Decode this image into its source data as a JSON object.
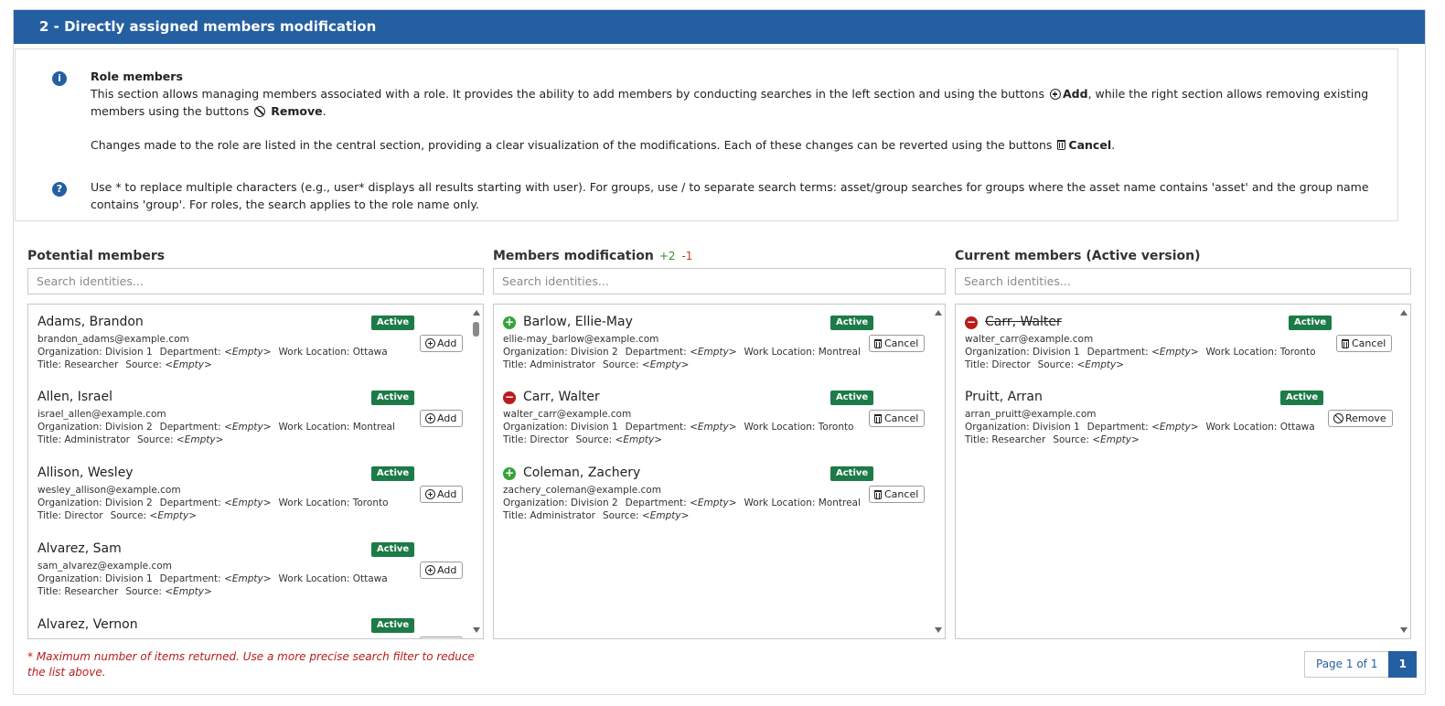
{
  "header": {
    "title": "2 - Directly assigned members modification"
  },
  "info": {
    "title": "Role members",
    "p1_a": "This section allows managing members associated with a role. It provides the ability to add members by conducting searches in the left section and using the buttons",
    "p1_add": "Add",
    "p1_b": ", while the right section allows removing existing members using the buttons",
    "p1_remove": "Remove",
    "p1_end": ".",
    "p2_a": "Changes made to the role are listed in the central section, providing a clear visualization of the modifications. Each of these changes can be reverted using the buttons",
    "p2_cancel": "Cancel",
    "p2_end": ".",
    "help": "Use * to replace multiple characters (e.g., user* displays all results starting with user). For groups, use / to separate search terms: asset/group searches for groups where the asset name contains 'asset' and the group name contains 'group'. For roles, the search applies to the role name only."
  },
  "labels": {
    "organization": "Organization:",
    "department": "Department:",
    "work_location": "Work Location:",
    "title": "Title:",
    "source": "Source:",
    "empty": "<Empty>",
    "active": "Active",
    "add": "Add",
    "cancel": "Cancel",
    "remove": "Remove"
  },
  "columns": {
    "potential": {
      "title": "Potential members",
      "search_placeholder": "Search identities...",
      "items": [
        {
          "name": "Adams, Brandon",
          "email": "brandon_adams@example.com",
          "organization": "Division 1",
          "work_location": "Ottawa",
          "title": "Researcher"
        },
        {
          "name": "Allen, Israel",
          "email": "israel_allen@example.com",
          "organization": "Division 2",
          "work_location": "Montreal",
          "title": "Administrator"
        },
        {
          "name": "Allison, Wesley",
          "email": "wesley_allison@example.com",
          "organization": "Division 2",
          "work_location": "Toronto",
          "title": "Director"
        },
        {
          "name": "Alvarez, Sam",
          "email": "sam_alvarez@example.com",
          "organization": "Division 1",
          "work_location": "Ottawa",
          "title": "Researcher"
        },
        {
          "name": "Alvarez, Vernon"
        }
      ]
    },
    "modification": {
      "title": "Members modification",
      "delta_plus": "+2",
      "delta_minus": "-1",
      "search_placeholder": "Search identities...",
      "items": [
        {
          "change": "add",
          "name": "Barlow, Ellie-May",
          "email": "ellie-may_barlow@example.com",
          "organization": "Division 2",
          "work_location": "Montreal",
          "title": "Administrator"
        },
        {
          "change": "remove",
          "name": "Carr, Walter",
          "email": "walter_carr@example.com",
          "organization": "Division 1",
          "work_location": "Toronto",
          "title": "Director"
        },
        {
          "change": "add",
          "name": "Coleman, Zachery",
          "email": "zachery_coleman@example.com",
          "organization": "Division 2",
          "work_location": "Montreal",
          "title": "Administrator"
        }
      ]
    },
    "current": {
      "title": "Current members (Active version)",
      "search_placeholder": "Search identities...",
      "items": [
        {
          "change": "remove",
          "name": "Carr, Walter",
          "email": "walter_carr@example.com",
          "organization": "Division 1",
          "work_location": "Toronto",
          "title": "Director"
        },
        {
          "name": "Pruitt, Arran",
          "email": "arran_pruitt@example.com",
          "organization": "Division 1",
          "work_location": "Ottawa",
          "title": "Researcher"
        }
      ]
    }
  },
  "footnote": "* Maximum number of items returned. Use a more precise search filter to reduce the list above.",
  "pager": {
    "label": "Page 1 of 1",
    "current": "1"
  },
  "colors": {
    "header": "#245fa1",
    "badge": "#1c7b47",
    "add": "#37a339",
    "remove": "#b81c1c"
  }
}
